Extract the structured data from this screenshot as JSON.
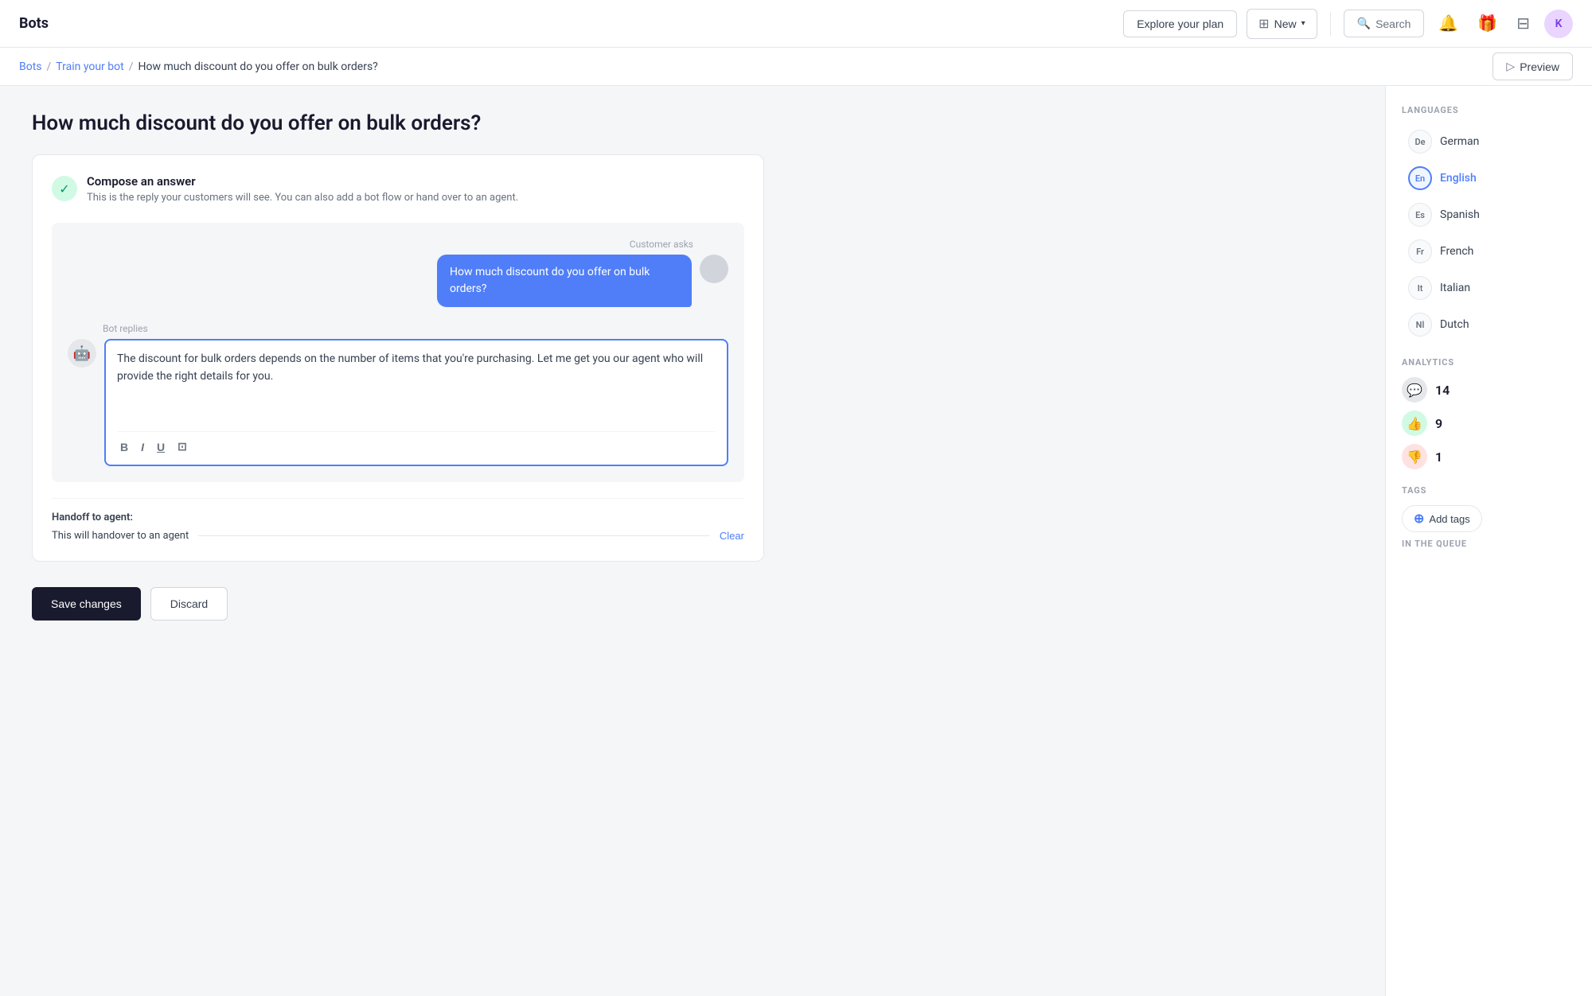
{
  "topnav": {
    "logo": "Bots",
    "explore_btn": "Explore your plan",
    "new_btn": "New",
    "search_btn": "Search",
    "avatar_initial": "K"
  },
  "breadcrumb": {
    "bots": "Bots",
    "train": "Train your bot",
    "current": "How much discount do you offer on bulk orders?"
  },
  "preview_btn": "Preview",
  "page": {
    "title": "How much discount do you offer on bulk orders?",
    "compose": {
      "heading": "Compose an answer",
      "subtext": "This is the reply your customers will see. You can also add a bot flow or hand over to an agent."
    },
    "customer_asks_label": "Customer asks",
    "customer_message": "How much discount do you offer on bulk orders?",
    "bot_replies_label": "Bot replies",
    "bot_reply_text": "The discount for bulk orders depends on the number of items that you're purchasing. Let me get you our agent who will provide the right details for you.",
    "handoff_label": "Handoff to agent:",
    "handoff_text": "This will handover to an agent",
    "clear_btn": "Clear",
    "save_btn": "Save changes",
    "discard_btn": "Discard"
  },
  "sidebar": {
    "languages_title": "LANGUAGES",
    "languages": [
      {
        "code": "De",
        "name": "German",
        "active": false
      },
      {
        "code": "En",
        "name": "English",
        "active": true
      },
      {
        "code": "Es",
        "name": "Spanish",
        "active": false
      },
      {
        "code": "Fr",
        "name": "French",
        "active": false
      },
      {
        "code": "It",
        "name": "Italian",
        "active": false
      },
      {
        "code": "Nl",
        "name": "Dutch",
        "active": false
      }
    ],
    "analytics_title": "ANALYTICS",
    "analytics": [
      {
        "type": "neutral",
        "count": "14",
        "icon": "💬"
      },
      {
        "type": "positive",
        "count": "9",
        "icon": "👍"
      },
      {
        "type": "negative",
        "count": "1",
        "icon": "👎"
      }
    ],
    "tags_title": "TAGS",
    "add_tags_label": "Add tags",
    "queue_title": "IN THE QUEUE"
  }
}
